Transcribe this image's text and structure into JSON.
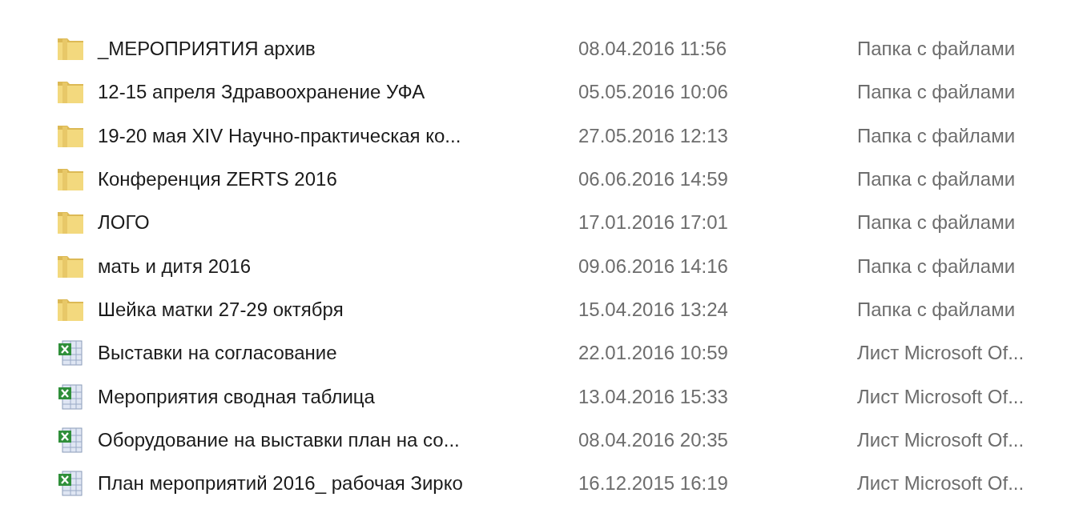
{
  "files": [
    {
      "kind": "folder",
      "name": "_МЕРОПРИЯТИЯ архив",
      "date": "08.04.2016 11:56",
      "type": "Папка с файлами"
    },
    {
      "kind": "folder",
      "name": "12-15 апреля Здравоохранение УФА",
      "date": "05.05.2016 10:06",
      "type": "Папка с файлами"
    },
    {
      "kind": "folder",
      "name": "19-20 мая XIV Научно-практическая ко...",
      "date": "27.05.2016 12:13",
      "type": "Папка с файлами"
    },
    {
      "kind": "folder",
      "name": "Конференция  ZERTS 2016",
      "date": "06.06.2016 14:59",
      "type": "Папка с файлами"
    },
    {
      "kind": "folder",
      "name": "ЛОГО",
      "date": "17.01.2016 17:01",
      "type": "Папка с файлами"
    },
    {
      "kind": "folder",
      "name": "мать и дитя 2016",
      "date": "09.06.2016 14:16",
      "type": "Папка с файлами"
    },
    {
      "kind": "folder",
      "name": "Шейка матки 27-29 октября",
      "date": "15.04.2016 13:24",
      "type": "Папка с файлами"
    },
    {
      "kind": "sheet",
      "name": "Выставки на согласование",
      "date": "22.01.2016 10:59",
      "type": "Лист Microsoft Of..."
    },
    {
      "kind": "sheet",
      "name": "Мероприятия сводная таблица",
      "date": "13.04.2016 15:33",
      "type": "Лист Microsoft Of..."
    },
    {
      "kind": "sheet",
      "name": "Оборудование на выставки план на со...",
      "date": "08.04.2016 20:35",
      "type": "Лист Microsoft Of..."
    },
    {
      "kind": "sheet",
      "name": "План мероприятий 2016_ рабочая Зирко",
      "date": "16.12.2015 16:19",
      "type": "Лист Microsoft Of..."
    }
  ]
}
